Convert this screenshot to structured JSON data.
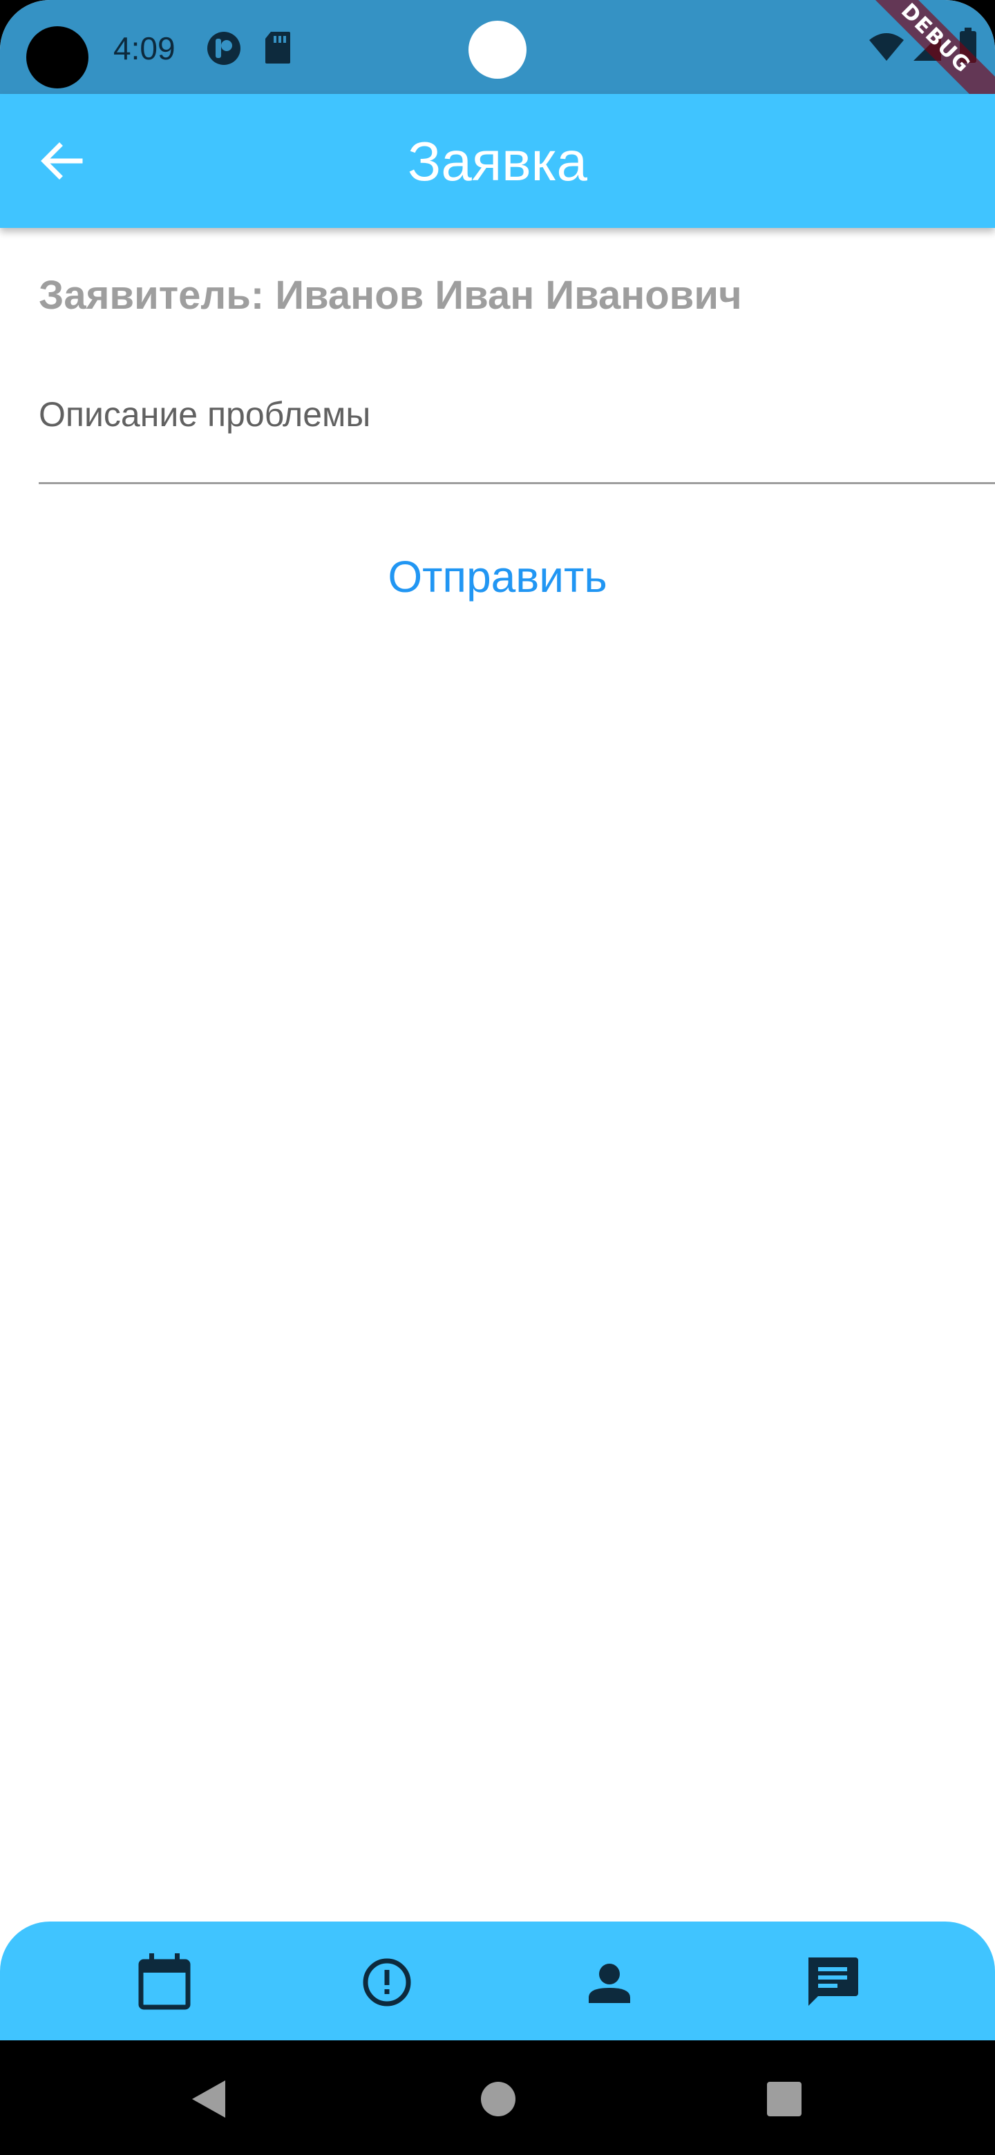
{
  "status_bar": {
    "time": "4:09",
    "debug_label": "DEBUG"
  },
  "app_bar": {
    "title": "Заявка",
    "back_icon": "arrow-back-icon"
  },
  "form": {
    "applicant_text": "Заявитель: Иванов Иван Иванович",
    "description_placeholder": "Описание проблемы",
    "description_value": "",
    "submit_label": "Отправить"
  },
  "bottom_nav": {
    "items": [
      {
        "icon": "calendar-icon"
      },
      {
        "icon": "alert-circle-icon"
      },
      {
        "icon": "person-icon"
      },
      {
        "icon": "chat-icon"
      }
    ]
  },
  "colors": {
    "status_bar": "#3592c4",
    "app_bar": "#40c4ff",
    "accent": "#2196f3",
    "applicant_text": "#9e9e9e",
    "nav_icon": "#0d2a3d"
  }
}
